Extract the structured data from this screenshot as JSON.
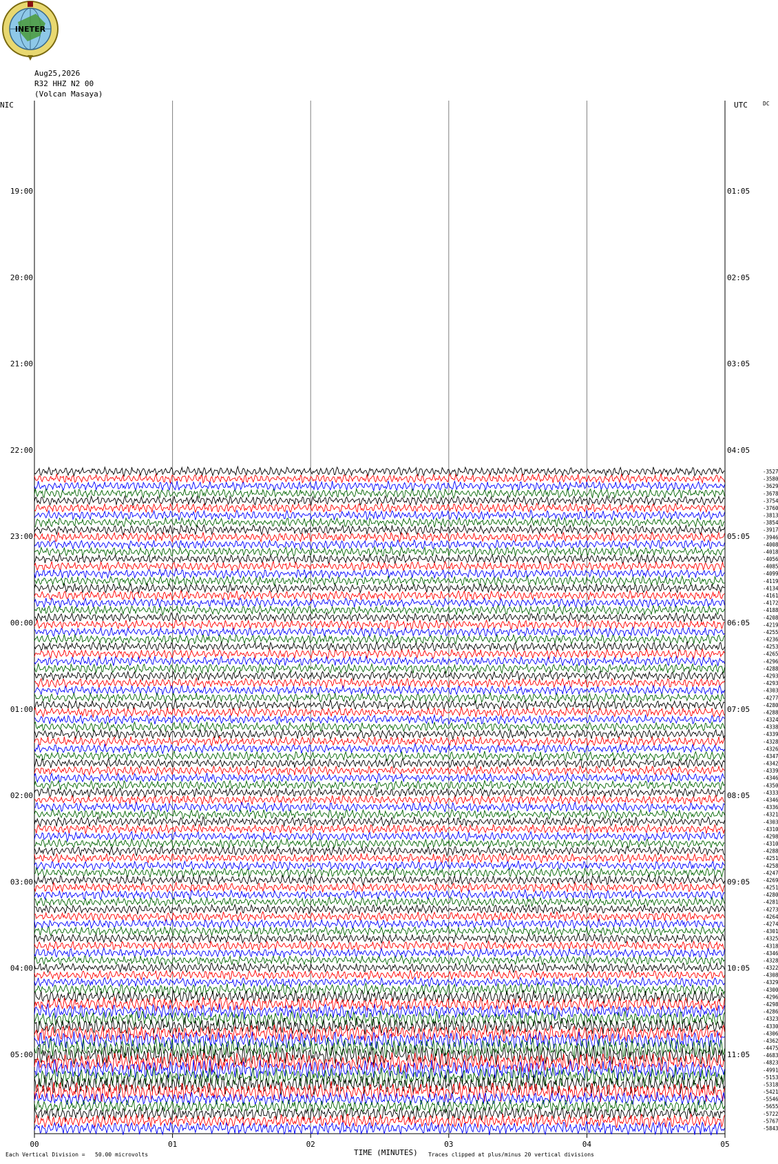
{
  "header": {
    "logo_text": "INETER",
    "date": "Aug25,2026",
    "station": "R32 HHZ N2 00",
    "location": "(Volcan Masaya)",
    "left_zone": "NIC",
    "right_zone": "UTC",
    "dc_label": "DC"
  },
  "footer": {
    "scale_text": "Each Vertical Division =   50.00 microvolts",
    "xlabel": "TIME (MINUTES)",
    "clip_text": "Traces clipped at plus/minus 20 vertical divisions"
  },
  "colors": {
    "black": "#000000",
    "red": "#ff0000",
    "blue": "#0000ff",
    "green": "#006400",
    "grid": "#808080"
  },
  "chart_data": {
    "type": "line",
    "title": "Aug25,2026 R32 HHZ N2 00 (Volcan Masaya)",
    "xlabel": "TIME (MINUTES)",
    "x_ticks": [
      "00",
      "01",
      "02",
      "03",
      "04",
      "05"
    ],
    "xlim": [
      0,
      5
    ],
    "left_hour_labels": [
      "19:00",
      "20:00",
      "21:00",
      "22:00",
      "23:00",
      "00:00",
      "01:00",
      "02:00",
      "03:00",
      "04:00",
      "05:00"
    ],
    "right_hour_labels": [
      "01:05",
      "02:05",
      "03:05",
      "04:05",
      "05:05",
      "06:05",
      "07:05",
      "08:05",
      "09:05",
      "10:05",
      "11:05"
    ],
    "trace_colors": [
      "black",
      "red",
      "blue",
      "green"
    ],
    "trace_offsets": [
      "-3527",
      "-3580",
      "-3629",
      "-3678",
      "-3754",
      "-3760",
      "-3813",
      "-3854",
      "-3917",
      "-3946",
      "-4008",
      "-4018",
      "-4056",
      "-4085",
      "-4099",
      "-4119",
      "-4134",
      "-4161",
      "-4172",
      "-4188",
      "-4208",
      "-4219",
      "-4255",
      "-4236",
      "-4253",
      "-4265",
      "-4296",
      "-4288",
      "-4293",
      "-4293",
      "-4303",
      "-4277",
      "-4280",
      "-4288",
      "-4324",
      "-4338",
      "-4339",
      "-4328",
      "-4326",
      "-4347",
      "-4342",
      "-4339",
      "-4346",
      "-4350",
      "-4333",
      "-4346",
      "-4336",
      "-4321",
      "-4303",
      "-4310",
      "-4298",
      "-4310",
      "-4288",
      "-4251",
      "-4258",
      "-4247",
      "-4269",
      "-4251",
      "-4280",
      "-4281",
      "-4273",
      "-4264",
      "-4274",
      "-4301",
      "-4325",
      "-4318",
      "-4346",
      "-4328",
      "-4322",
      "-4308",
      "-4329",
      "-4300",
      "-4296",
      "-4298",
      "-4286",
      "-4323",
      "-4330",
      "-4306",
      "-4362",
      "-4475",
      "-4683",
      "-4823",
      "-4991",
      "-5153",
      "-5318",
      "-5421",
      "-5546",
      "-5655",
      "-5722",
      "-5767",
      "-5843"
    ],
    "scale": "Each Vertical Division = 50.00 microvolts",
    "clipping": "Traces clipped at plus/minus 20 vertical divisions",
    "grid": true
  }
}
